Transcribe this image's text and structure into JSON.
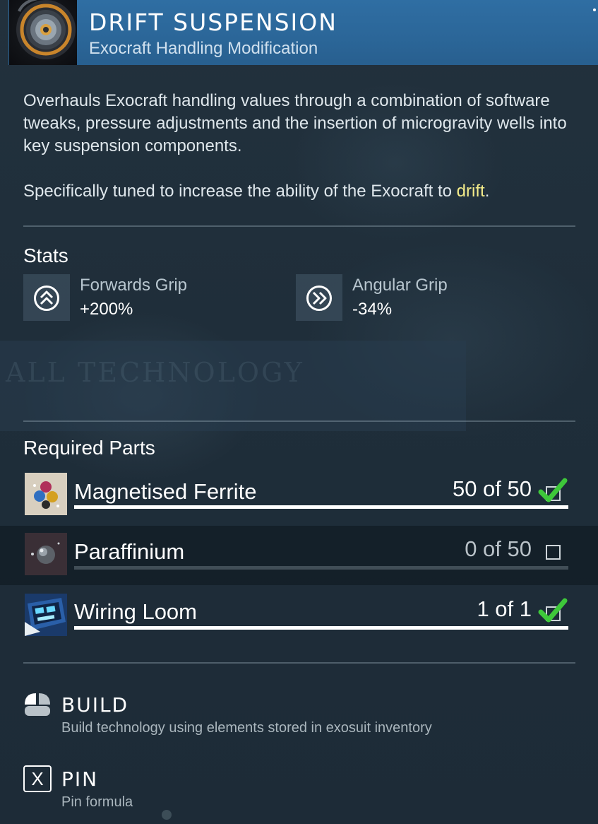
{
  "header": {
    "title": "DRIFT SUSPENSION",
    "subtitle": "Exocraft Handling Modification",
    "icon": "suspension-wheel-icon",
    "accent_color": "#2f6ea3"
  },
  "description": {
    "paragraph1": "Overhauls Exocraft handling values through a combination of software tweaks, pressure adjustments and the insertion of microgravity wells into key suspension components.",
    "paragraph2_before": "Specifically tuned to increase the ability of the Exocraft to ",
    "paragraph2_highlight": "drift",
    "paragraph2_after": ".",
    "highlight_color": "#f4ec8a"
  },
  "stats": {
    "title": "Stats",
    "items": [
      {
        "name": "Forwards Grip",
        "value": "+200%",
        "icon": "double-chevron-up-icon"
      },
      {
        "name": "Angular Grip",
        "value": "-34%",
        "icon": "double-chevron-right-icon"
      }
    ]
  },
  "parts": {
    "title": "Required Parts",
    "items": [
      {
        "name": "Magnetised Ferrite",
        "count": "50 of 50",
        "have": 50,
        "need": 50,
        "complete": true,
        "icon": "magnetised-ferrite-icon"
      },
      {
        "name": "Paraffinium",
        "count": "0 of 50",
        "have": 0,
        "need": 50,
        "complete": false,
        "icon": "paraffinium-icon"
      },
      {
        "name": "Wiring Loom",
        "count": "1 of 1",
        "have": 1,
        "need": 1,
        "complete": true,
        "icon": "wiring-loom-icon"
      }
    ],
    "check_color": "#3ec83a"
  },
  "actions": {
    "build": {
      "label": "BUILD",
      "description": "Build technology using elements stored in exosuit inventory",
      "icon": "mouse-icon"
    },
    "pin": {
      "label": "PIN",
      "description": "Pin formula",
      "icon": "x-key-icon",
      "key": "X"
    }
  },
  "background": {
    "ghost_heading": "ALL TECHNOLOGY"
  }
}
